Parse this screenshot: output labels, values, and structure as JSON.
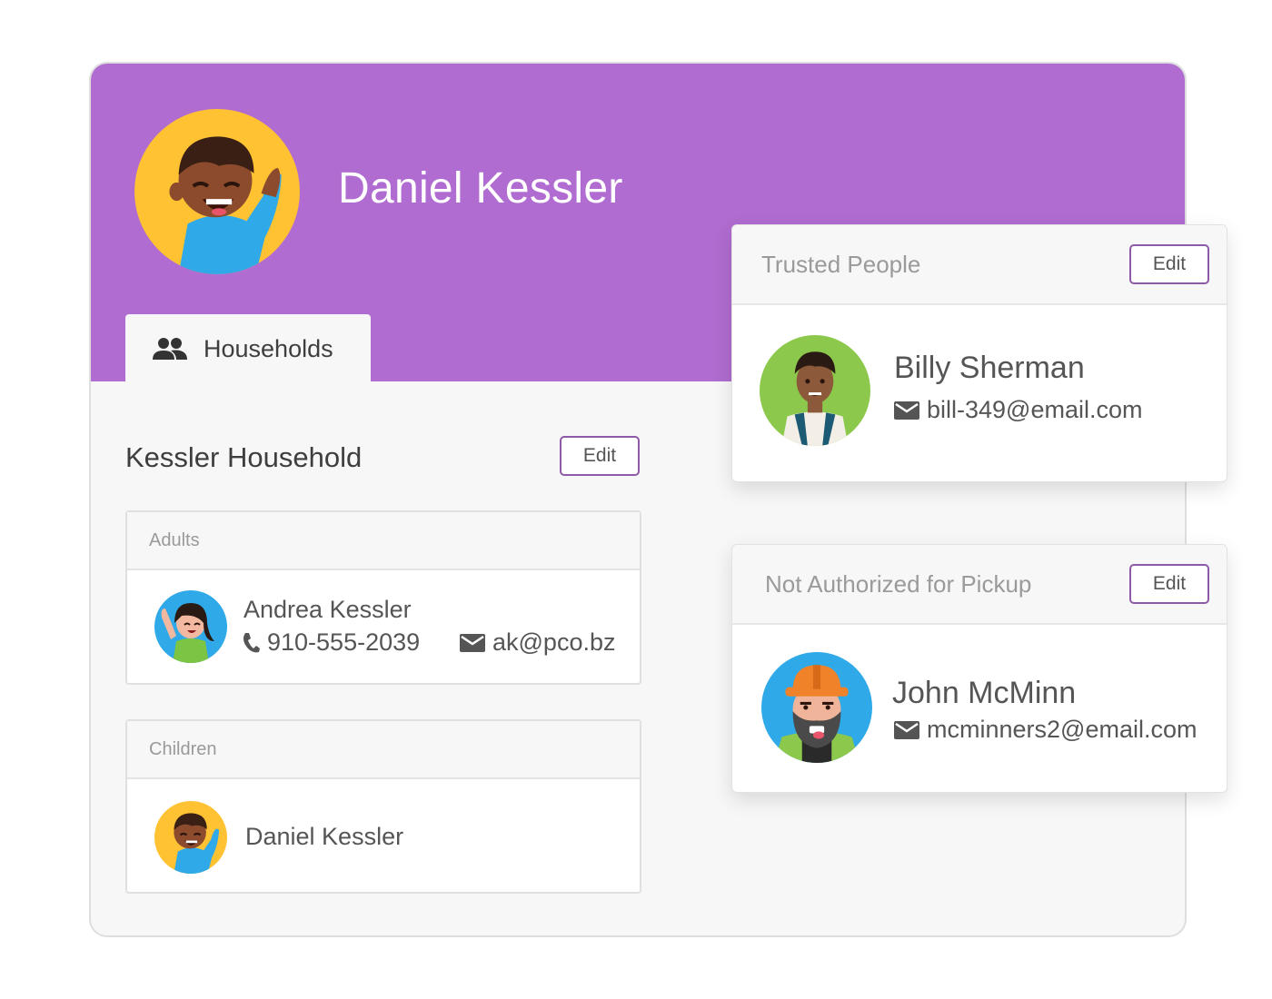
{
  "profile": {
    "name": "Daniel Kessler",
    "header_color": "#b06cd0"
  },
  "tabs": [
    {
      "label": "Households",
      "icon": "people-icon",
      "active": true
    }
  ],
  "household": {
    "title": "Kessler Household",
    "edit_label": "Edit",
    "adults": {
      "heading": "Adults",
      "people": [
        {
          "name": "Andrea Kessler",
          "phone": "910-555-2039",
          "email": "ak@pco.bz"
        }
      ]
    },
    "children": {
      "heading": "Children",
      "people": [
        {
          "name": "Daniel Kessler"
        }
      ]
    }
  },
  "trusted_people": {
    "heading": "Trusted People",
    "edit_label": "Edit",
    "people": [
      {
        "name": "Billy Sherman",
        "email": "bill-349@email.com"
      }
    ]
  },
  "not_authorized": {
    "heading": "Not Authorized for Pickup",
    "edit_label": "Edit",
    "people": [
      {
        "name": "John McMinn",
        "email": "mcminners2@email.com"
      }
    ]
  },
  "colors": {
    "accent": "#8e5aa8",
    "avatar_yellow": "#ffc233",
    "avatar_blue": "#2fa9e8",
    "avatar_green": "#8cc84b"
  }
}
